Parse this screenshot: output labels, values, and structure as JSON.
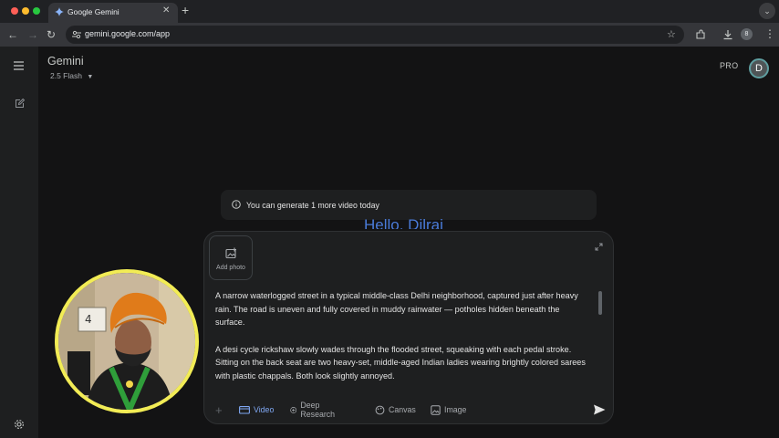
{
  "browser": {
    "tab_title": "Google Gemini",
    "url": "gemini.google.com/app",
    "profile_initial": "8"
  },
  "app": {
    "title": "Gemini",
    "model": "2.5 Flash",
    "pro_label": "PRO",
    "avatar_initial": "D"
  },
  "toast": {
    "text": "You can generate 1 more video today"
  },
  "greeting": "Hello, Dilraj",
  "composer": {
    "add_photo_label": "Add photo",
    "paragraphs": [
      "A narrow waterlogged street in a typical middle-class Delhi neighborhood, captured just after heavy rain. The road is uneven and fully covered in muddy rainwater — potholes hidden beneath the surface.",
      "A desi cycle rickshaw slowly wades through the flooded street, squeaking with each pedal stroke. Sitting on the back seat are two heavy-set, middle-aged Indian ladies wearing brightly colored sarees with plastic chappals. Both look slightly annoyed."
    ],
    "tools": [
      {
        "label": "Video",
        "icon": "video-icon",
        "active": true
      },
      {
        "label": "Deep Research",
        "icon": "deep-research-icon",
        "active": false
      },
      {
        "label": "Canvas",
        "icon": "canvas-icon",
        "active": false
      },
      {
        "label": "Image",
        "icon": "image-icon",
        "active": false
      }
    ]
  },
  "webcam": {
    "sign_number": "4"
  },
  "colors": {
    "accent": "#7fa7f2",
    "greeting": "#4a7bd9",
    "webcam_ring": "#f2ec55"
  }
}
